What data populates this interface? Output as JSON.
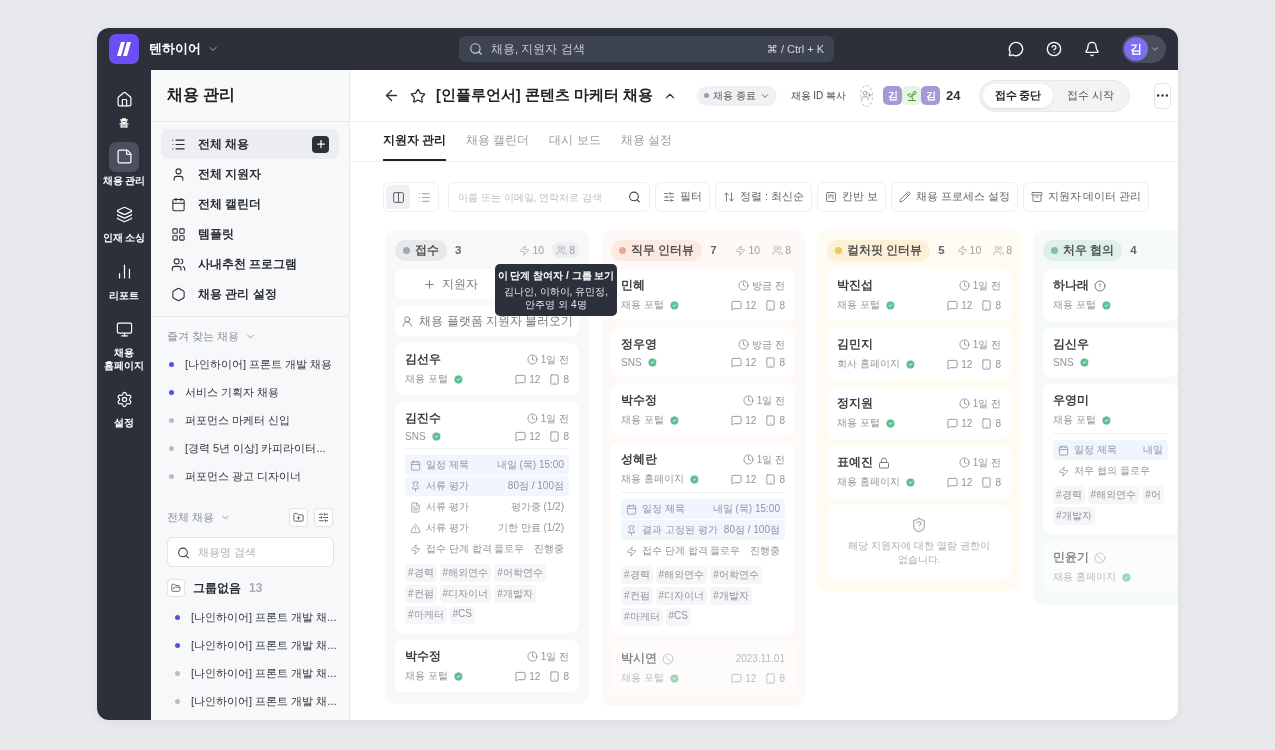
{
  "top_bar": {
    "workspace": "텐하이어",
    "search_placeholder": "채용, 지원자 검색",
    "shortcut": "⌘ / Ctrl + K",
    "avatar": "김"
  },
  "rail": [
    {
      "label": "홈",
      "selected": false
    },
    {
      "label": "채용 관리",
      "selected": true
    },
    {
      "label": "인재 소싱",
      "selected": false
    },
    {
      "label": "리포트",
      "selected": false
    },
    {
      "label": "채용 홈페이지",
      "selected": false
    },
    {
      "label": "설정",
      "selected": false
    }
  ],
  "sidebar": {
    "title": "채용 관리",
    "nav": [
      {
        "label": "전체 채용",
        "selected": true
      },
      {
        "label": "전체 지원자",
        "selected": false
      },
      {
        "label": "전체 캘린더",
        "selected": false
      },
      {
        "label": "템플릿",
        "selected": false
      },
      {
        "label": "사내추천 프로그램",
        "selected": false
      },
      {
        "label": "채용 관리 설정",
        "selected": false
      }
    ],
    "favorites": {
      "title": "즐겨 찾는 채용",
      "items": [
        {
          "label": "[나인하이어] 프론트 개발 채용",
          "color": "#5a4ee0"
        },
        {
          "label": "서비스 기획자 채용",
          "color": "#5a4ee0"
        },
        {
          "label": "퍼포먼스 마케터 신입",
          "color": "#b8bbc2"
        },
        {
          "label": "[경력 5년 이상] 카피라이터...",
          "color": "#b8bbc2"
        },
        {
          "label": "퍼포먼스 광고 디자이너",
          "color": "#b8bbc2"
        }
      ]
    },
    "all": {
      "title": "전체 채용",
      "search_placeholder": "채용명 검색",
      "group": {
        "name": "그룹없음",
        "count": "13",
        "items": [
          {
            "label": "[나인하이어] 프론트 개발 채...",
            "color": "#5a4ee0"
          },
          {
            "label": "[나인하이어] 프론트 개발 채...",
            "color": "#5a4ee0"
          },
          {
            "label": "[나인하이어] 프론트 개발 채...",
            "color": "#b8bbc2"
          },
          {
            "label": "[나인하이어] 프론트 개발 채...",
            "color": "#b8bbc2"
          }
        ]
      }
    }
  },
  "header": {
    "title": "[인플루언서] 콘텐츠 마케터 채용",
    "status": "채용 종료",
    "copy_id": "채용 ID 복사",
    "members": [
      {
        "kind": "initial",
        "text": "김"
      },
      {
        "kind": "sprout"
      },
      {
        "kind": "initial",
        "text": "김"
      }
    ],
    "member_count": "24",
    "toggle": [
      {
        "label": "접수 중단",
        "selected": true
      },
      {
        "label": "접수 시작",
        "selected": false
      }
    ]
  },
  "tabs": [
    {
      "label": "지원자 관리",
      "selected": true
    },
    {
      "label": "채용 캘린더",
      "selected": false
    },
    {
      "label": "대시 보드",
      "selected": false
    },
    {
      "label": "채용 설정",
      "selected": false
    }
  ],
  "toolbar": {
    "views": [
      {
        "selected": true
      },
      {
        "selected": false
      }
    ],
    "search_placeholder": "이름 또는 이메일, 연락처로 검색",
    "buttons": [
      "필터",
      "정렬 : 최신순",
      "칸반 보",
      "채용 프로세스 설정",
      "지원자 데이터 관리"
    ]
  },
  "columns": [
    {
      "name": "접수",
      "count": "3",
      "color": "#a3a7ae",
      "flows": "10",
      "members": "8",
      "tooltip": {
        "title": "이 단계 참여자 / 그룹 보기",
        "text": "김나인, 이하이, 유민정, 안주영 외 4명"
      },
      "actions": [
        "지원자",
        "채용 플랫폼 지원자 불러오기"
      ],
      "cards": [
        {
          "kind": "normal",
          "name": "김선우",
          "time": "1일 전",
          "source": "채용 포털",
          "verified": true,
          "comments": "12",
          "docs": "8"
        },
        {
          "kind": "normal",
          "name": "김진수",
          "time": "1일 전",
          "source": "SNS",
          "verified": true,
          "comments": "12",
          "docs": "8",
          "rows": [
            {
              "kind": "schedule",
              "label": "일정 제목",
              "value": "내일 (목) 15:00",
              "highlight": true
            },
            {
              "kind": "score",
              "label": "서류 평가",
              "value": "80점 / 100점",
              "highlight": true
            },
            {
              "kind": "evaluation",
              "label": "서류 평가",
              "value": "평가중 (1/2)",
              "highlight": false
            },
            {
              "kind": "deadline",
              "label": "서류 평가",
              "value": "기한 만료 (1/2)",
              "highlight": false
            },
            {
              "kind": "flow",
              "label": "접수 단계 합격 플로우",
              "value": "진행중",
              "highlight": false
            }
          ],
          "tags": [
            "#경력",
            "#해외연수",
            "#어학연수",
            "#컨펌",
            "#디자이너",
            "#개발자",
            "#마케터",
            "#CS"
          ]
        },
        {
          "kind": "normal",
          "name": "박수정",
          "time": "1일 전",
          "source": "채용 포털",
          "verified": true,
          "comments": "12",
          "docs": "8"
        }
      ]
    },
    {
      "name": "직무 인터뷰",
      "count": "7",
      "color": "#f0a48c",
      "flows": "10",
      "members": "8",
      "cards": [
        {
          "kind": "normal",
          "name": "민혜",
          "time": "방금 전",
          "source": "채용 포털",
          "verified": true,
          "comments": "12",
          "docs": "8"
        },
        {
          "kind": "normal",
          "name": "정우영",
          "time": "방금 전",
          "source": "SNS",
          "verified": true,
          "comments": "12",
          "docs": "8"
        },
        {
          "kind": "normal",
          "name": "박수정",
          "time": "1일 전",
          "source": "채용 포털",
          "verified": true,
          "comments": "12",
          "docs": "8"
        },
        {
          "kind": "normal",
          "name": "성혜란",
          "time": "1일 전",
          "source": "채용 홈페이지",
          "verified": true,
          "comments": "12",
          "docs": "8",
          "rows": [
            {
              "kind": "schedule",
              "label": "일정 제목",
              "value": "내일 (목) 15:00",
              "highlight": true
            },
            {
              "kind": "score",
              "label": "결과 고정된 평가",
              "value": "80점 / 100점",
              "highlight": true
            },
            {
              "kind": "flow",
              "label": "접수 단계 합격 플로우",
              "value": "진행중",
              "highlight": false
            }
          ],
          "tags": [
            "#경력",
            "#해외연수",
            "#어학연수",
            "#컨펌",
            "#디자이너",
            "#개발자",
            "#마케터",
            "#CS"
          ]
        },
        {
          "kind": "blocked",
          "name": "박시연",
          "time": "2023.11.01",
          "source": "채용 포털",
          "verified": true,
          "comments": "12",
          "docs": "8"
        }
      ]
    },
    {
      "name": "컬처핏 인터뷰",
      "count": "5",
      "color": "#f2c65a",
      "flows": "10",
      "members": "8",
      "cards": [
        {
          "kind": "normal",
          "name": "박진섭",
          "time": "1일 전",
          "source": "채용 포털",
          "verified": true,
          "comments": "12",
          "docs": "8"
        },
        {
          "kind": "normal",
          "name": "김민지",
          "time": "1일 전",
          "source": "회사 홈페이지",
          "verified": true,
          "comments": "12",
          "docs": "8"
        },
        {
          "kind": "normal",
          "name": "정지원",
          "time": "1일 전",
          "source": "채용 포털",
          "verified": true,
          "comments": "12",
          "docs": "8"
        },
        {
          "kind": "locked",
          "name": "표예진",
          "time": "1일 전",
          "source": "채용 홈페이지",
          "verified": true,
          "comments": "12",
          "docs": "8"
        },
        {
          "kind": "notice",
          "text": "해당 지원자에 대한 열람 권한이 없습니다."
        }
      ]
    },
    {
      "name": "처우 협의",
      "count": "4",
      "color": "#7cc3a0",
      "cards": [
        {
          "kind": "alert",
          "name": "하나래",
          "source": "채용 포털",
          "verified": true
        },
        {
          "kind": "normal",
          "name": "김신우",
          "source": "SNS",
          "verified": true
        },
        {
          "kind": "normal",
          "name": "우영미",
          "source": "채용 포털",
          "verified": true,
          "rows": [
            {
              "kind": "schedule",
              "label": "일정 제목",
              "value": "내일",
              "highlight": true
            },
            {
              "kind": "flow",
              "label": "처우 협의 플로우",
              "highlight": false
            }
          ],
          "tags": [
            "#경력",
            "#해외연수",
            "#어",
            "#개발자"
          ]
        },
        {
          "kind": "blocked",
          "name": "민윤기",
          "source": "채용 홈페이지",
          "verified": true
        }
      ]
    }
  ]
}
